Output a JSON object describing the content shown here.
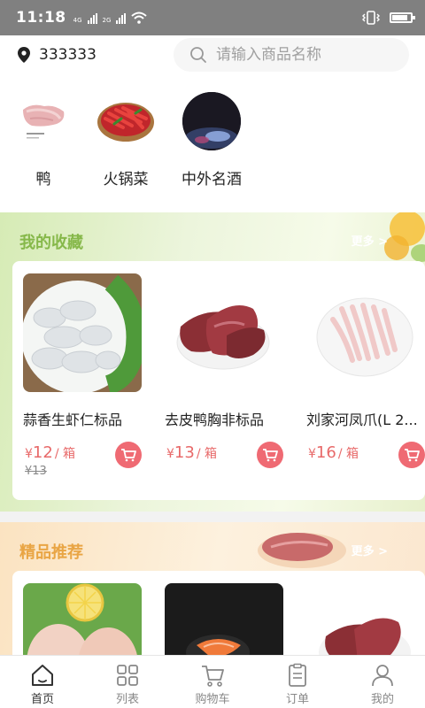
{
  "status_bar": {
    "time": "11:18",
    "net1": "4G",
    "net2": "2G",
    "battery_level": 0.75
  },
  "header": {
    "location": "333333",
    "search_placeholder": "请输入商品名称"
  },
  "categories": [
    {
      "label": "鸭",
      "image": "duck-feet-image"
    },
    {
      "label": "火锅菜",
      "image": "chili-dish-image"
    },
    {
      "label": "中外名酒",
      "image": "wine-image"
    }
  ],
  "favorites": {
    "title": "我的收藏",
    "more": "更多 >",
    "items": [
      {
        "name": "蒜香生虾仁标品",
        "currency": "¥",
        "price": "12",
        "unit": "/ 箱",
        "original_price": "¥13"
      },
      {
        "name": "去皮鸭胸非标品",
        "currency": "¥",
        "price": "13",
        "unit": "/ 箱"
      },
      {
        "name": "刘家河凤爪(L 2...",
        "currency": "¥",
        "price": "16",
        "unit": "/ 箱"
      }
    ]
  },
  "recommended": {
    "title": "精品推荐",
    "more": "更多 >"
  },
  "nav": [
    {
      "label": "首页",
      "icon": "home-icon",
      "active": true
    },
    {
      "label": "列表",
      "icon": "grid-icon",
      "active": false
    },
    {
      "label": "购物车",
      "icon": "cart-icon",
      "active": false
    },
    {
      "label": "订单",
      "icon": "order-icon",
      "active": false
    },
    {
      "label": "我的",
      "icon": "user-icon",
      "active": false
    }
  ],
  "colors": {
    "accent": "#ef6a73",
    "price": "#e86a6a",
    "fav_title": "#86b84a",
    "rec_title": "#e9a544"
  }
}
